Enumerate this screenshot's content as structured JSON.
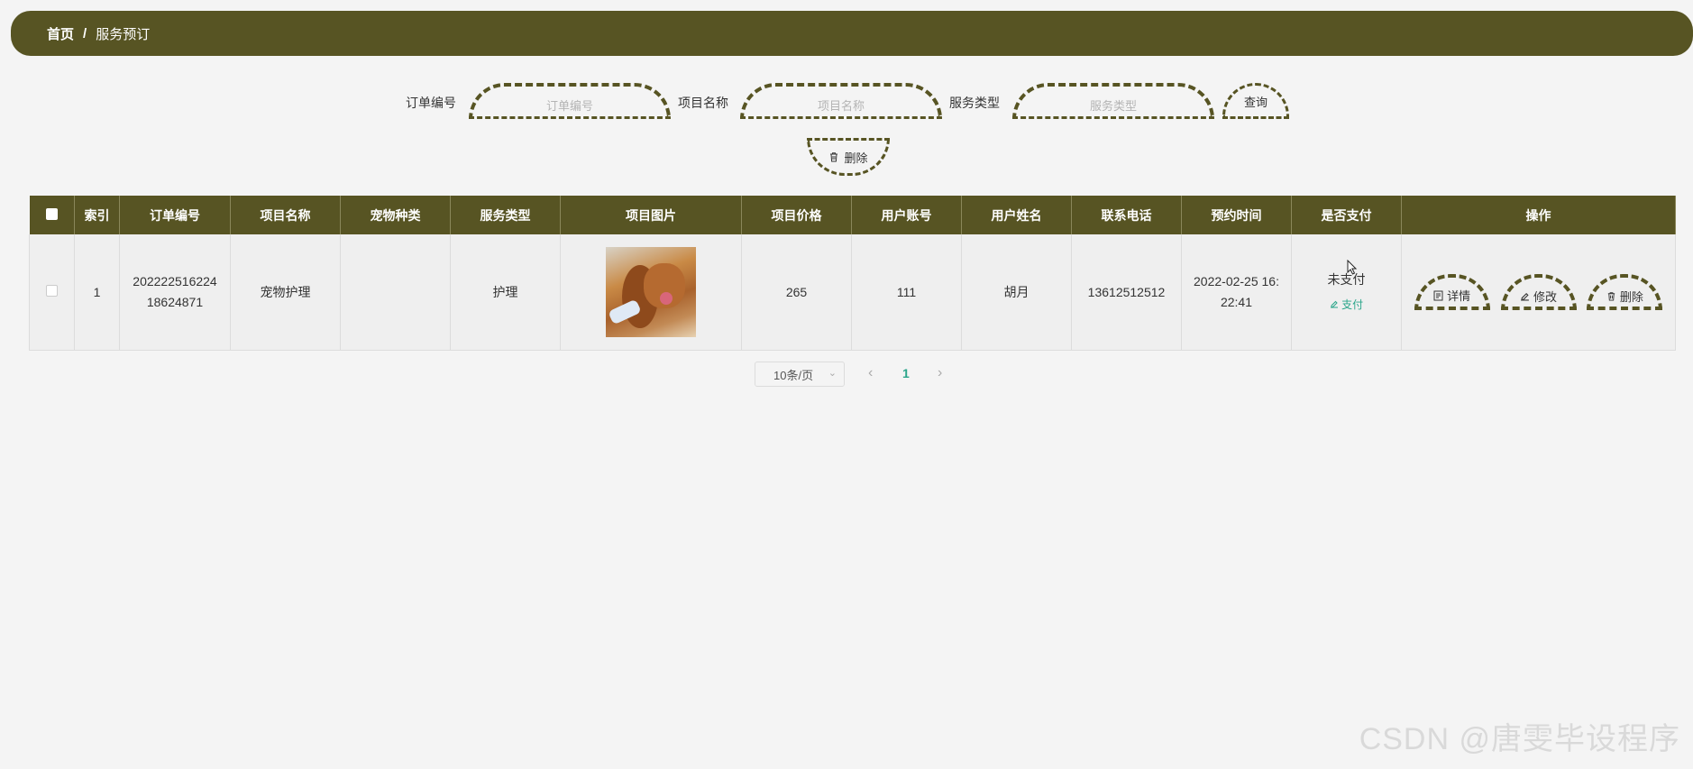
{
  "breadcrumb": {
    "home": "首页",
    "separator": "/",
    "current": "服务预订"
  },
  "search": {
    "order_no_label": "订单编号",
    "order_no_placeholder": "订单编号",
    "project_name_label": "项目名称",
    "project_name_placeholder": "项目名称",
    "service_type_label": "服务类型",
    "service_type_placeholder": "服务类型",
    "query_label": "查询"
  },
  "toolbar": {
    "delete_label": "删除"
  },
  "table": {
    "headers": [
      "",
      "索引",
      "订单编号",
      "项目名称",
      "宠物种类",
      "服务类型",
      "项目图片",
      "项目价格",
      "用户账号",
      "用户姓名",
      "联系电话",
      "预约时间",
      "是否支付",
      "操作"
    ],
    "rows": [
      {
        "index": "1",
        "order_no": "20222251622418624871",
        "project_name": "宠物护理",
        "pet_type": "",
        "service_type": "护理",
        "price": "265",
        "user_account": "111",
        "user_name": "胡月",
        "phone": "13612512512",
        "booking_time": "2022-02-25 16:22:41",
        "paid_status": "未支付",
        "pay_label": "支付",
        "detail_label": "详情",
        "edit_label": "修改",
        "delete_label": "删除"
      }
    ]
  },
  "pagination": {
    "page_size": "10条/页",
    "current_page": "1"
  },
  "watermark": "CSDN @唐雯毕设程序",
  "colors": {
    "theme": "#575423",
    "accent": "#2aa58a",
    "background": "#f4f4f4"
  }
}
